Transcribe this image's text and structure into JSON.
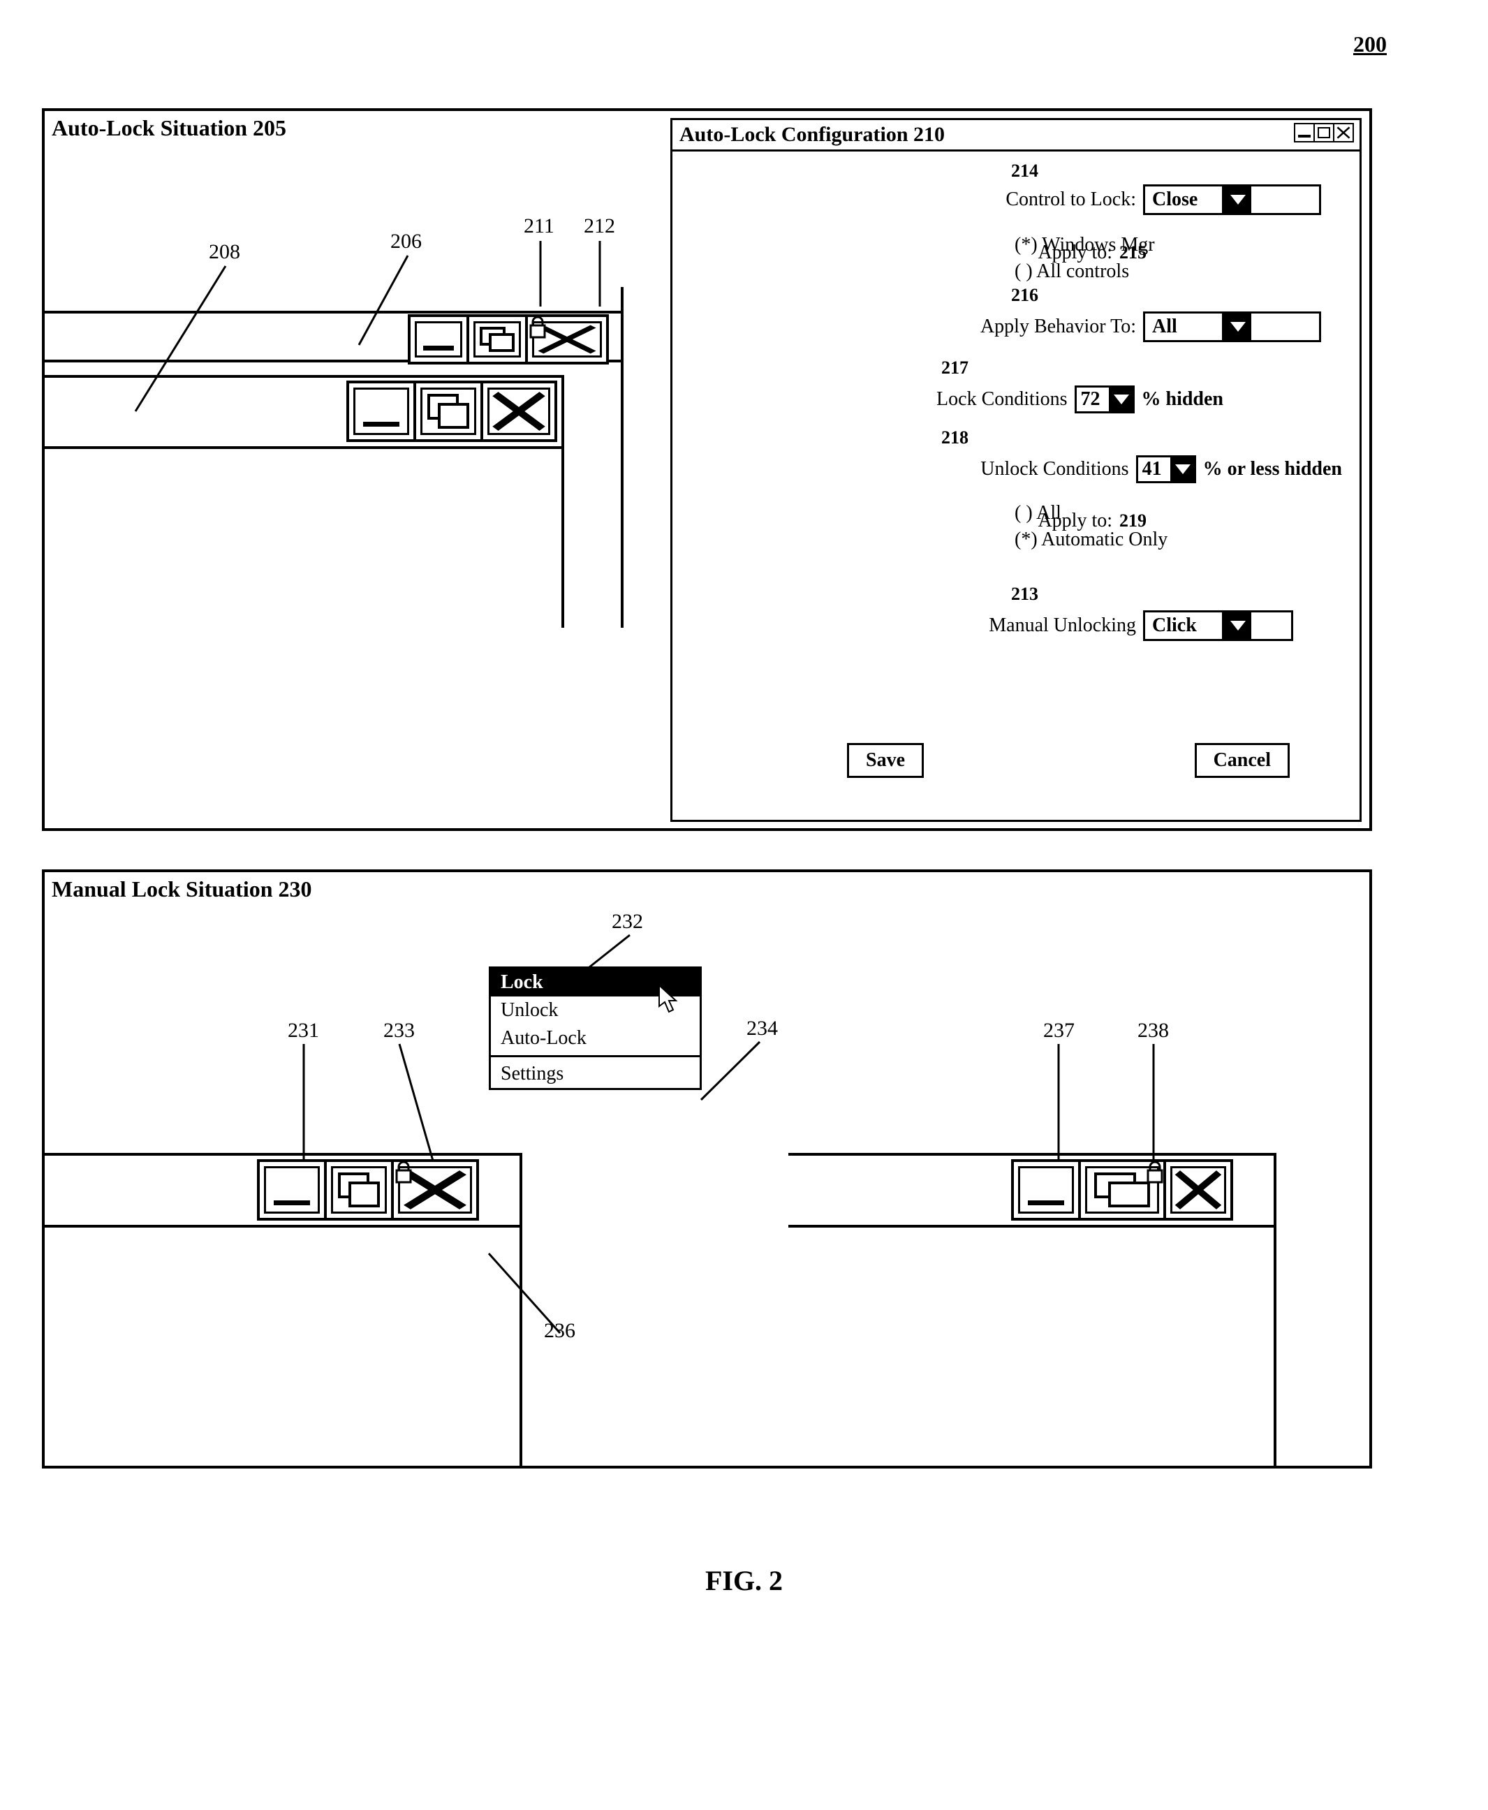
{
  "figure_number": "200",
  "figure_caption": "FIG. 2",
  "panel_a": {
    "title": "Auto-Lock Situation 205",
    "callouts": {
      "c208": "208",
      "c206": "206",
      "c211": "211",
      "c212": "212"
    }
  },
  "dialog": {
    "title": "Auto-Lock Configuration 210",
    "rows": {
      "control_to_lock": {
        "ref": "214",
        "label": "Control to Lock:",
        "value": "Close"
      },
      "apply_to_1": {
        "ref": "215",
        "label": "Apply to:",
        "opt1": "(*) Windows Mgr",
        "opt2": "(  ) All controls"
      },
      "apply_behavior": {
        "ref": "216",
        "label": "Apply Behavior To:",
        "value": "All"
      },
      "lock_cond": {
        "ref": "217",
        "label": "Lock Conditions",
        "value": "72",
        "suffix": "% hidden"
      },
      "unlock_cond": {
        "ref": "218",
        "label": "Unlock Conditions",
        "value": "41",
        "suffix": "% or less hidden"
      },
      "apply_to_2": {
        "ref": "219",
        "label": "Apply to:",
        "opt1": "(  ) All",
        "opt2": "(*) Automatic Only"
      },
      "manual_unlock": {
        "ref": "213",
        "label": "Manual Unlocking",
        "value": "Click"
      }
    },
    "buttons": {
      "save": "Save",
      "cancel": "Cancel"
    }
  },
  "panel_b": {
    "title": "Manual Lock Situation 230",
    "menu": {
      "lock": "Lock",
      "unlock": "Unlock",
      "autolock": "Auto-Lock",
      "settings": "Settings"
    },
    "callouts": {
      "c231": "231",
      "c232": "232",
      "c233": "233",
      "c234": "234",
      "c236": "236",
      "c237": "237",
      "c238": "238"
    }
  }
}
